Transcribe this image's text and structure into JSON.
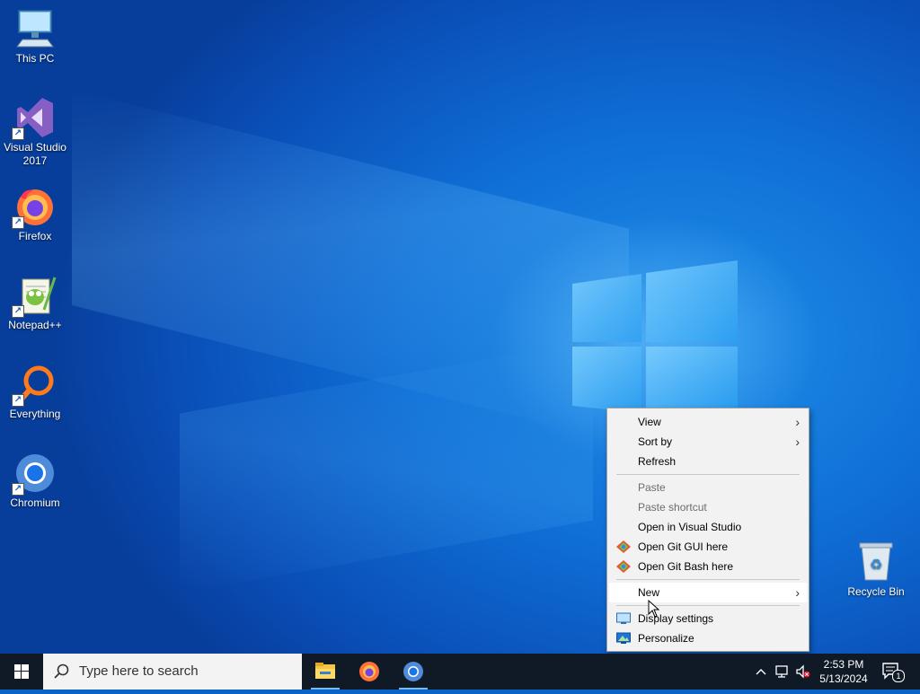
{
  "desktop": {
    "icons": [
      {
        "label": "This PC",
        "icon": "this-pc-icon"
      },
      {
        "label": "Visual Studio\n2017",
        "icon": "visual-studio-icon"
      },
      {
        "label": "Firefox",
        "icon": "firefox-icon"
      },
      {
        "label": "Notepad++",
        "icon": "notepadpp-icon"
      },
      {
        "label": "Everything",
        "icon": "everything-icon"
      },
      {
        "label": "Chromium",
        "icon": "chromium-icon"
      },
      {
        "label": "Recycle Bin",
        "icon": "recycle-bin-icon"
      }
    ]
  },
  "context_menu": {
    "items": [
      {
        "label": "View",
        "submenu": true,
        "enabled": true
      },
      {
        "label": "Sort by",
        "submenu": true,
        "enabled": true
      },
      {
        "label": "Refresh",
        "enabled": true
      },
      {
        "label": "Paste",
        "enabled": false
      },
      {
        "label": "Paste shortcut",
        "enabled": false
      },
      {
        "label": "Open in Visual Studio",
        "enabled": true
      },
      {
        "label": "Open Git GUI here",
        "enabled": true,
        "icon": "git-gui-icon"
      },
      {
        "label": "Open Git Bash here",
        "enabled": true,
        "icon": "git-bash-icon"
      },
      {
        "label": "New",
        "submenu": true,
        "enabled": true,
        "highlighted": true
      },
      {
        "label": "Display settings",
        "enabled": true,
        "icon": "display-settings-icon"
      },
      {
        "label": "Personalize",
        "enabled": true,
        "icon": "personalize-icon"
      }
    ]
  },
  "taskbar": {
    "search_placeholder": "Type here to search",
    "pinned_apps": [
      "file-explorer-icon",
      "firefox-icon",
      "chromium-icon"
    ],
    "clock_time": "2:53 PM",
    "clock_date": "5/13/2024",
    "notification_count": "1"
  },
  "colors": {
    "taskbar": "#0f1a26",
    "menu_bg": "#f2f2f2",
    "accent": "#0a64c8"
  }
}
